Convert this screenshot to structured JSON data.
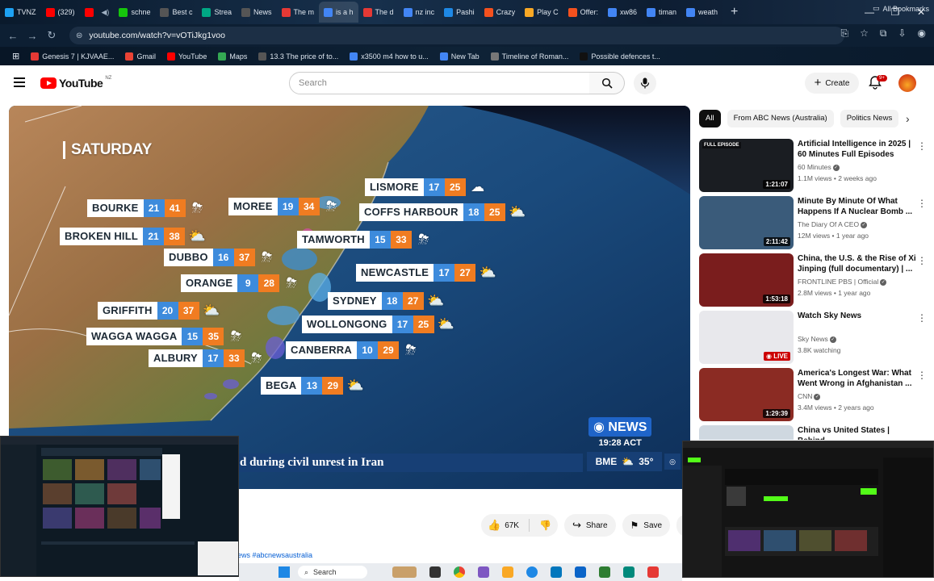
{
  "browser": {
    "tabs": [
      {
        "label": "TVNZ",
        "color": "#1da1f2"
      },
      {
        "label": "(329)",
        "color": "#ff0000"
      },
      {
        "label": "",
        "color": "#ff0000"
      },
      {
        "label": "schne",
        "color": "#16c60c"
      },
      {
        "label": "Best c",
        "color": "#555555"
      },
      {
        "label": "Strea",
        "color": "#00a884"
      },
      {
        "label": "News",
        "color": "#555555"
      },
      {
        "label": "The m",
        "color": "#e53935"
      },
      {
        "label": "is a h",
        "color": "#4285f4"
      },
      {
        "label": "The d",
        "color": "#e53935"
      },
      {
        "label": "nz inc",
        "color": "#4285f4"
      },
      {
        "label": "Pashi",
        "color": "#1e88e5"
      },
      {
        "label": "Crazy",
        "color": "#f4511e"
      },
      {
        "label": "Play C",
        "color": "#f9a825"
      },
      {
        "label": "Offer:",
        "color": "#f4511e"
      },
      {
        "label": "xw86",
        "color": "#4285f4"
      },
      {
        "label": "timan",
        "color": "#4285f4"
      },
      {
        "label": "weath",
        "color": "#4285f4"
      }
    ],
    "new_tab": "+",
    "url": "youtube.com/watch?v=vOTiJkg1voo",
    "bookmarks": [
      {
        "label": "Genesis 7 | KJVAAE...",
        "color": "#e53935"
      },
      {
        "label": "Gmail",
        "color": "#ea4335"
      },
      {
        "label": "YouTube",
        "color": "#ff0000"
      },
      {
        "label": "Maps",
        "color": "#34a853"
      },
      {
        "label": "13.3 The price of to...",
        "color": "#555555"
      },
      {
        "label": "x3500 m4 how to u...",
        "color": "#4285f4"
      },
      {
        "label": "New Tab",
        "color": "#4285f4"
      },
      {
        "label": "Timeline of Roman...",
        "color": "#777777"
      },
      {
        "label": "Possible defences t...",
        "color": "#111111"
      }
    ],
    "all_bookmarks": "All Bookmarks"
  },
  "youtube": {
    "logo": "YouTube",
    "region": "NZ",
    "search_placeholder": "Search",
    "create_label": "Create",
    "notif_count": "9+"
  },
  "video": {
    "day": "SATURDAY",
    "cities": [
      {
        "name": "LISMORE",
        "min": "17",
        "max": "25",
        "wx": "cloud"
      },
      {
        "name": "BOURKE",
        "min": "21",
        "max": "41",
        "wx": "storm"
      },
      {
        "name": "MOREE",
        "min": "19",
        "max": "34",
        "wx": "storm"
      },
      {
        "name": "COFFS HARBOUR",
        "min": "18",
        "max": "25",
        "wx": "sun-cloud"
      },
      {
        "name": "BROKEN HILL",
        "min": "21",
        "max": "38",
        "wx": "sun-cloud"
      },
      {
        "name": "TAMWORTH",
        "min": "15",
        "max": "33",
        "wx": "storm"
      },
      {
        "name": "DUBBO",
        "min": "16",
        "max": "37",
        "wx": "storm"
      },
      {
        "name": "ORANGE",
        "min": "9",
        "max": "28",
        "wx": "storm"
      },
      {
        "name": "NEWCASTLE",
        "min": "17",
        "max": "27",
        "wx": "sun-cloud"
      },
      {
        "name": "SYDNEY",
        "min": "18",
        "max": "27",
        "wx": "sun-cloud"
      },
      {
        "name": "GRIFFITH",
        "min": "20",
        "max": "37",
        "wx": "sun-cloud"
      },
      {
        "name": "WOLLONGONG",
        "min": "17",
        "max": "25",
        "wx": "sun-cloud"
      },
      {
        "name": "WAGGA WAGGA",
        "min": "15",
        "max": "35",
        "wx": "storm"
      },
      {
        "name": "CANBERRA",
        "min": "10",
        "max": "29",
        "wx": "storm"
      },
      {
        "name": "ALBURY",
        "min": "17",
        "max": "33",
        "wx": "storm"
      },
      {
        "name": "BEGA",
        "min": "13",
        "max": "29",
        "wx": "sun-cloud"
      }
    ],
    "news_logo": "NEWS",
    "news_time": "19:28 ACT",
    "ticker": "d during civil unrest in Iran",
    "temp_city": "BME",
    "temp_value": "35°",
    "likes": "67K",
    "share_label": "Share",
    "save_label": "Save",
    "hashtags": "ews #abcnewsaustralia"
  },
  "sidebar": {
    "chips": [
      "All",
      "From ABC News (Australia)",
      "Politics News"
    ],
    "videos": [
      {
        "title": "Artificial Intelligence in 2025 | 60 Minutes Full Episodes",
        "channel": "60 Minutes",
        "meta": "1.1M views • 2 weeks ago",
        "duration": "1:21:07",
        "badge": "FULL EPISODE",
        "thumb": "#1a1d22"
      },
      {
        "title": "Minute By Minute Of What Happens If A Nuclear Bomb ...",
        "channel": "The Diary Of A CEO",
        "meta": "12M views • 1 year ago",
        "duration": "2:11:42",
        "badge": "",
        "thumb": "#3a5b7a"
      },
      {
        "title": "China, the U.S. & the Rise of Xi Jinping (full documentary) | ...",
        "channel": "FRONTLINE PBS | Official",
        "meta": "2.8M views • 1 year ago",
        "duration": "1:53:18",
        "badge": "",
        "thumb": "#7a1d1d"
      },
      {
        "title": "Watch Sky News",
        "channel": "Sky News",
        "meta": "3.8K watching",
        "duration": "LIVE",
        "badge": "",
        "thumb": "#e8e8ec"
      },
      {
        "title": "America's Longest War: What Went Wrong in Afghanistan ...",
        "channel": "CNN",
        "meta": "3.4M views • 2 years ago",
        "duration": "1:29:39",
        "badge": "",
        "thumb": "#8b2b23"
      },
      {
        "title": "China vs United States | Behind",
        "channel": "",
        "meta": "",
        "duration": "",
        "badge": "",
        "thumb": "#cfd8e0"
      }
    ]
  },
  "taskbar": {
    "search_label": "Search"
  }
}
